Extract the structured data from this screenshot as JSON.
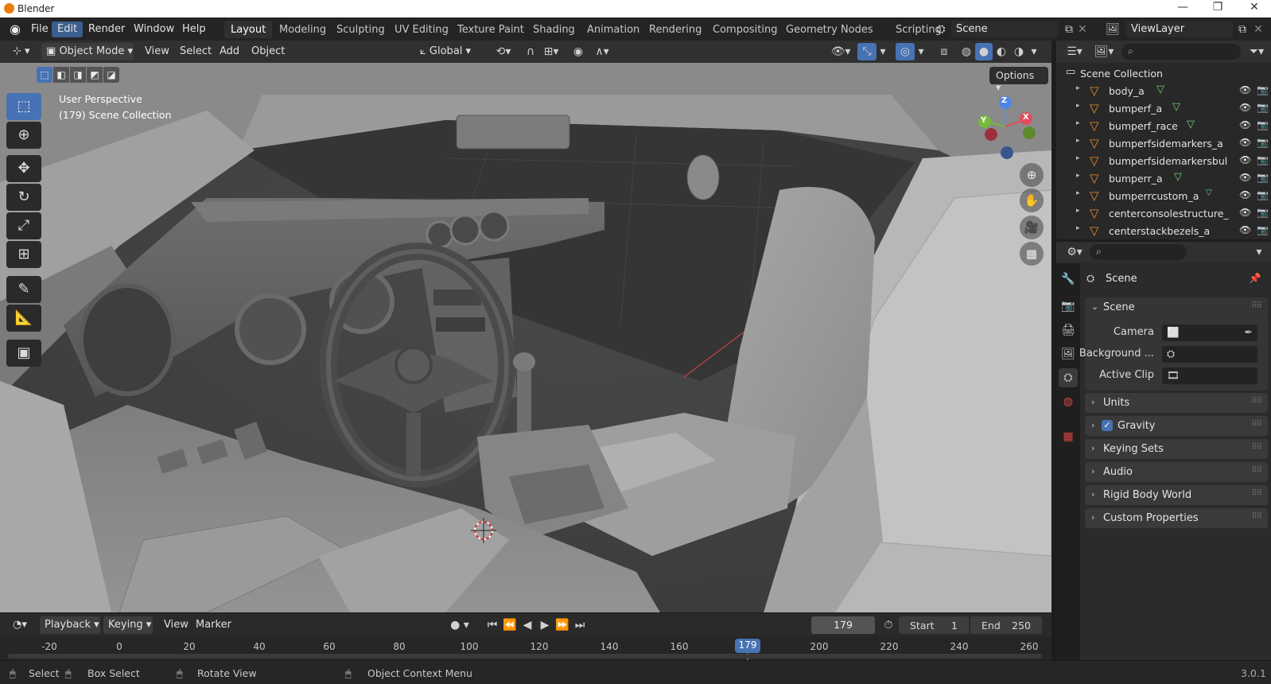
{
  "window": {
    "title": "Blender",
    "minimize": "—",
    "maximize": "❐",
    "close": "✕"
  },
  "menu": {
    "items": [
      {
        "label": "File",
        "active": false
      },
      {
        "label": "Edit",
        "active": true
      },
      {
        "label": "Render",
        "active": false
      },
      {
        "label": "Window",
        "active": false
      },
      {
        "label": "Help",
        "active": false
      }
    ],
    "workspaces": [
      "Layout",
      "Modeling",
      "Sculpting",
      "UV Editing",
      "Texture Paint",
      "Shading",
      "Animation",
      "Rendering",
      "Compositing",
      "Geometry Nodes",
      "Scripting"
    ],
    "active_workspace": "Layout",
    "scene": "Scene",
    "view_layer": "ViewLayer"
  },
  "viewport_header": {
    "mode": "Object Mode",
    "menus": [
      "View",
      "Select",
      "Add",
      "Object"
    ],
    "orientation": "Global",
    "options": "Options"
  },
  "viewport": {
    "perspective": "User Perspective",
    "collection": "(179) Scene Collection",
    "gizmo": {
      "z": "Z",
      "y": "Y",
      "x": "X"
    }
  },
  "tools": [
    {
      "name": "select-box",
      "glyph": "⬚",
      "active": true
    },
    {
      "name": "cursor",
      "glyph": "⊕",
      "active": false
    },
    {
      "name": "move",
      "glyph": "✥",
      "active": false
    },
    {
      "name": "rotate",
      "glyph": "↻",
      "active": false
    },
    {
      "name": "scale",
      "glyph": "⤢",
      "active": false
    },
    {
      "name": "transform",
      "glyph": "⊞",
      "active": false
    },
    {
      "name": "annotate",
      "glyph": "✎",
      "active": false
    },
    {
      "name": "measure",
      "glyph": "📐",
      "active": false
    },
    {
      "name": "add-cube",
      "glyph": "▣",
      "active": false
    }
  ],
  "timeline": {
    "menus": [
      "Playback",
      "Keying",
      "View",
      "Marker"
    ],
    "current_frame": "179",
    "start_label": "Start",
    "start": "1",
    "end_label": "End",
    "end": "250",
    "ticks": [
      "-20",
      "0",
      "20",
      "40",
      "60",
      "80",
      "100",
      "120",
      "140",
      "160",
      "200",
      "220",
      "240",
      "260"
    ],
    "playhead": "179"
  },
  "status": {
    "select": "Select",
    "box_select": "Box Select",
    "rotate_view": "Rotate View",
    "context_menu": "Object Context Menu",
    "version": "3.0.1"
  },
  "outliner": {
    "root": "Scene Collection",
    "items": [
      {
        "name": "body_a",
        "mesh": true
      },
      {
        "name": "bumperf_a",
        "mesh": true
      },
      {
        "name": "bumperf_race",
        "mesh": true
      },
      {
        "name": "bumperfsidemarkers_a",
        "mesh": false
      },
      {
        "name": "bumperfsidemarkersbul",
        "mesh": false
      },
      {
        "name": "bumperr_a",
        "mesh": true
      },
      {
        "name": "bumperrcustom_a",
        "mesh": true
      },
      {
        "name": "centerconsolestructure_",
        "mesh": false
      },
      {
        "name": "centerstackbezels_a",
        "mesh": false
      }
    ]
  },
  "properties": {
    "header": "Scene",
    "scene_panel": "Scene",
    "fields": [
      {
        "label": "Camera"
      },
      {
        "label": "Background ..."
      },
      {
        "label": "Active Clip"
      }
    ],
    "panels": [
      "Units",
      "Gravity",
      "Keying Sets",
      "Audio",
      "Rigid Body World",
      "Custom Properties"
    ],
    "gravity_checked": true
  }
}
